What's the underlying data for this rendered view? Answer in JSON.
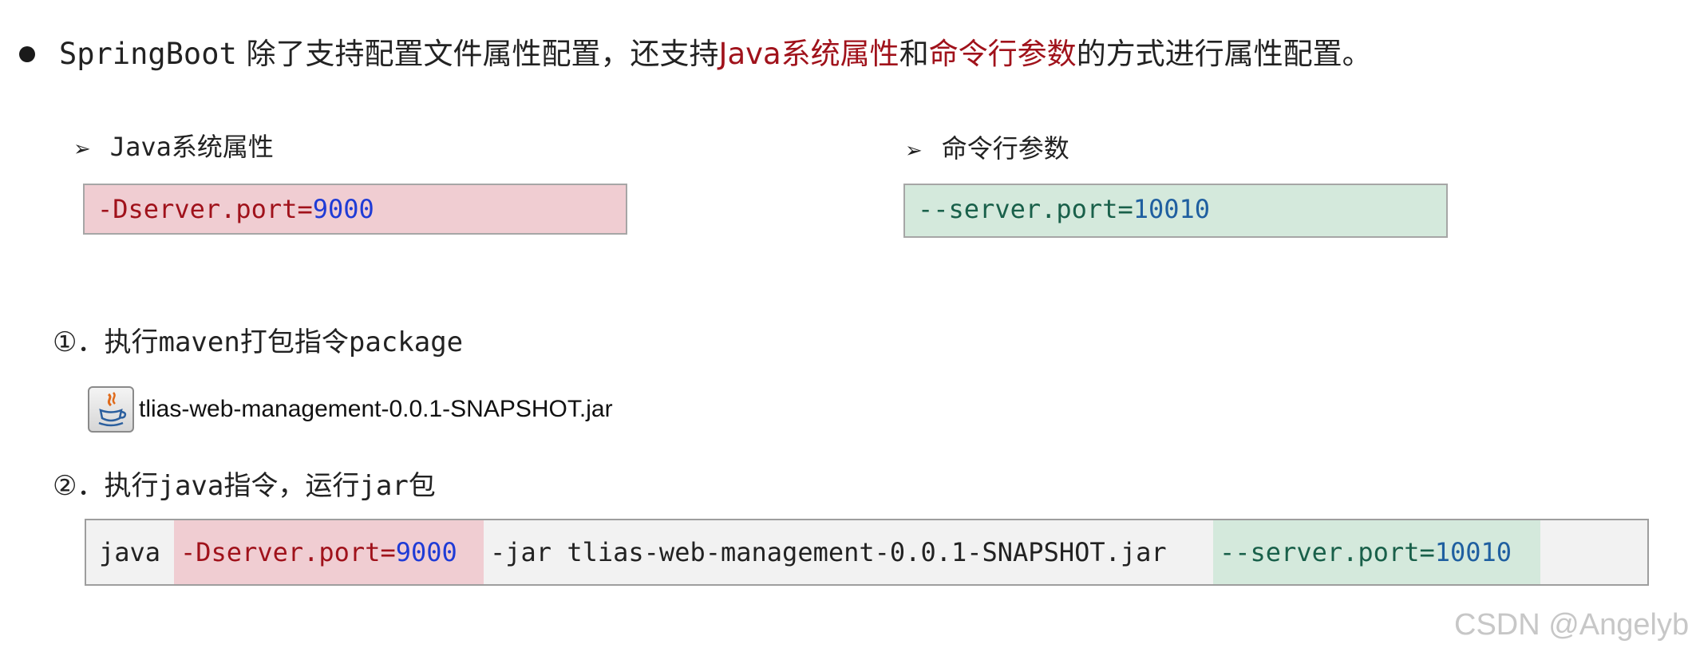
{
  "intro": {
    "lead": "SpringBoot",
    "part1": " 除了支持配置文件属性配置，还支持",
    "java_props": "Java系统属性",
    "and": "和",
    "cmd_args": "命令行参数",
    "part2": "的方式进行属性配置。"
  },
  "left_section": {
    "arrow": "➢",
    "title_mono": "Java",
    "title_rest": "系统属性",
    "code_key": "-Dserver.port=",
    "code_value": "9000"
  },
  "right_section": {
    "arrow": "➢",
    "title": "命令行参数",
    "code_key": "--server.port=",
    "code_value": "10010"
  },
  "step1": {
    "num": "①．",
    "text_a": "执行",
    "text_b": "maven",
    "text_c": "打包指令",
    "text_d": "package"
  },
  "jar_file": {
    "name": "tlias-web-management-0.0.1-SNAPSHOT.jar"
  },
  "step2": {
    "num": "②．",
    "text_a": "执行",
    "text_b": "java",
    "text_c": "指令，运行",
    "text_d": "jar",
    "text_e": "包"
  },
  "command": {
    "java": "java",
    "d_key": "-Dserver.port=",
    "d_value": "9000",
    "middle": "-jar tlias-web-management-0.0.1-SNAPSHOT.jar",
    "s_key": "--server.port=",
    "s_value": "10010"
  },
  "watermark": "CSDN @Angelyb",
  "colors": {
    "highlight_red": "#a0121b",
    "pink_bg": "#f0cdd2",
    "green_bg": "#d4e9dc",
    "number_blue": "#1f3bd6"
  }
}
